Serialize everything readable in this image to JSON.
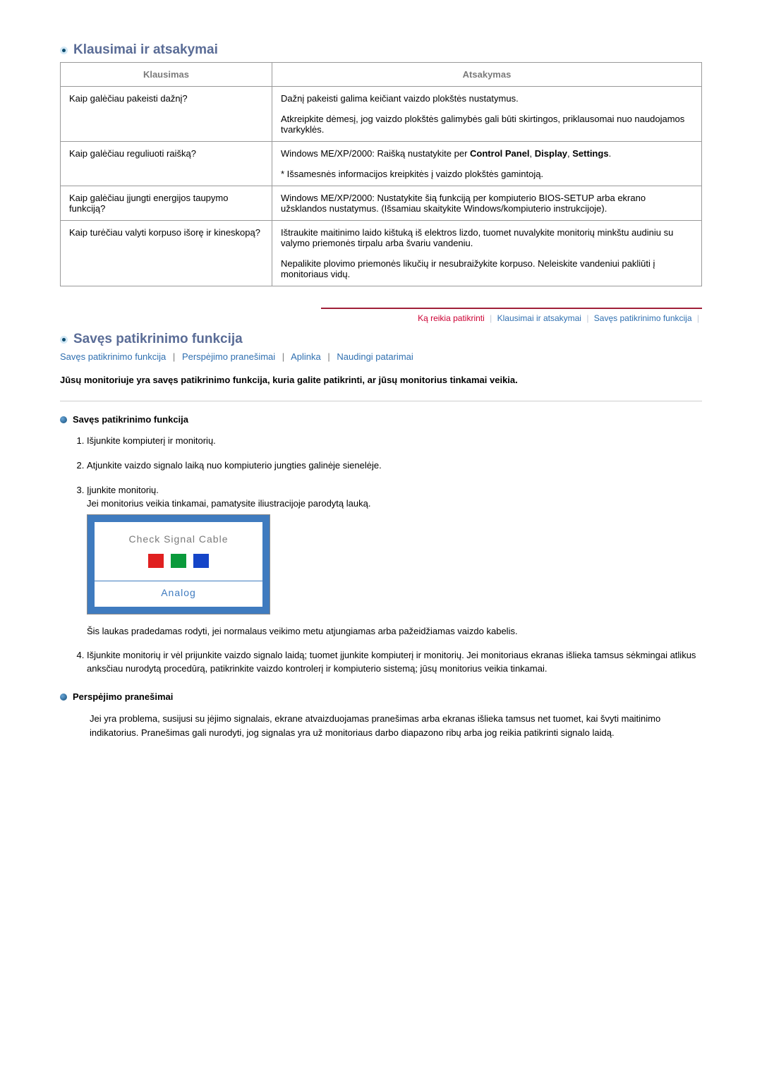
{
  "section1": {
    "title": "Klausimai ir atsakymai",
    "headers": {
      "q": "Klausimas",
      "a": "Atsakymas"
    },
    "rows": [
      {
        "q": "Kaip galėčiau pakeisti dažnį?",
        "a1": "Dažnį pakeisti galima keičiant vaizdo plokštės nustatymus.",
        "a2": "Atkreipkite dėmesį, jog vaizdo plokštės galimybės gali būti skirtingos, priklausomai nuo naudojamos tvarkyklės."
      },
      {
        "q": "Kaip galėčiau reguliuoti raišką?",
        "a1_pre": "Windows ME/XP/2000: Raišką nustatykite per ",
        "a1_bold1": "Control Panel",
        "a1_mid": ", ",
        "a1_bold2": "Display",
        "a1_mid2": ", ",
        "a1_bold3": "Settings",
        "a1_post": ".",
        "a2": "* Išsamesnės informacijos kreipkitės į vaizdo plokštės gamintoją."
      },
      {
        "q": "Kaip galėčiau įjungti energijos taupymo funkciją?",
        "a1": "Windows ME/XP/2000: Nustatykite šią funkciją per kompiuterio BIOS-SETUP arba ekrano užsklandos nustatymus. (Išsamiau skaitykite Windows/kompiuterio instrukcijoje)."
      },
      {
        "q": "Kaip turėčiau valyti korpuso išorę ir kineskopą?",
        "a1": "Ištraukite maitinimo laido kištuką iš elektros lizdo, tuomet nuvalykite monitorių minkštu audiniu su valymo priemonės tirpalu arba švariu vandeniu.",
        "a2": "Nepalikite plovimo priemonės likučių ir nesubraižykite korpuso. Neleiskite vandeniui pakliūti į monitoriaus vidų."
      }
    ]
  },
  "subnav": {
    "items": [
      {
        "label": "Ką reikia patikrinti",
        "cls": "red"
      },
      {
        "label": "Klausimai ir atsakymai",
        "cls": "blue"
      },
      {
        "label": "Savęs patikrinimo funkcija",
        "cls": "blue"
      }
    ]
  },
  "section2": {
    "title": "Savęs patikrinimo funkcija",
    "links": [
      "Savęs patikrinimo funkcija",
      "Perspėjimo pranešimai",
      "Aplinka",
      "Naudingi patarimai"
    ],
    "intro": "Jūsų monitoriuje yra savęs patikrinimo funkcija, kuria galite patikrinti, ar jūsų monitorius tinkamai veikia.",
    "subsec1": {
      "heading": "Savęs patikrinimo funkcija",
      "steps": {
        "s1": "Išjunkite kompiuterį ir monitorių.",
        "s2": "Atjunkite vaizdo signalo laiką nuo kompiuterio jungties galinėje sienelėje.",
        "s3a": "Įjunkite monitorių.",
        "s3b": "Jei monitorius veikia tinkamai, pamatysite iliustracijoje parodytą lauką.",
        "illus": {
          "line1": "Check Signal Cable",
          "line2": "Analog"
        },
        "after_illus": "Šis laukas pradedamas rodyti, jei normalaus veikimo metu atjungiamas arba pažeidžiamas vaizdo kabelis.",
        "s4": "Išjunkite monitorių ir vėl prijunkite vaizdo signalo laidą; tuomet įjunkite kompiuterį ir monitorių. Jei monitoriaus ekranas išlieka tamsus sėkmingai atlikus anksčiau nurodytą procedūrą, patikrinkite vaizdo kontrolerį ir kompiuterio sistemą; jūsų monitorius veikia tinkamai."
      }
    },
    "subsec2": {
      "heading": "Perspėjimo pranešimai",
      "para": "Jei yra problema, susijusi su įėjimo signalais, ekrane atvaizduojamas pranešimas arba ekranas išlieka tamsus net tuomet, kai švyti maitinimo indikatorius. Pranešimas gali nurodyti, jog signalas yra už monitoriaus darbo diapazono ribų arba jog reikia patikrinti signalo laidą."
    }
  }
}
